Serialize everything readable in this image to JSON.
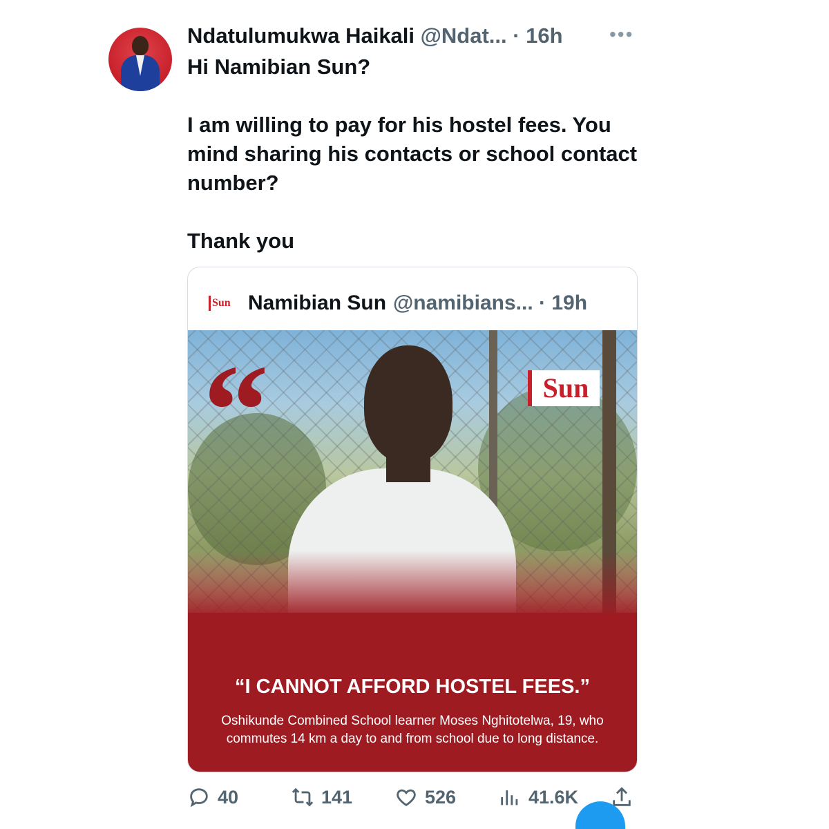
{
  "tweet": {
    "author_name": "Ndatulumukwa Haikali",
    "meta": "@Ndat... · 16h",
    "body": {
      "line1": "Hi Namibian Sun?",
      "line2": "I am willing to pay for his hostel fees. You mind sharing his contacts or school contact number?",
      "line3": "Thank you"
    }
  },
  "quoted": {
    "author_name": "Namibian Sun",
    "meta": "@namibians... · 19h",
    "logo_text": "Sun",
    "image": {
      "quote_mark": "“",
      "logo_text": "Sun",
      "headline": "“I CANNOT AFFORD HOSTEL FEES.”",
      "caption": "Oshikunde Combined School learner Moses Nghitotelwa, 19, who commutes 14 km a day to and from school due to long distance."
    }
  },
  "actions": {
    "replies": "40",
    "retweets": "141",
    "likes": "526",
    "views": "41.6K"
  },
  "icons": [
    "more-icon",
    "reply-icon",
    "retweet-icon",
    "like-icon",
    "views-icon",
    "share-icon"
  ],
  "colors": {
    "accent_red": "#9e1b22",
    "muted_text": "#536471",
    "twitter_blue": "#1d9bf0"
  }
}
